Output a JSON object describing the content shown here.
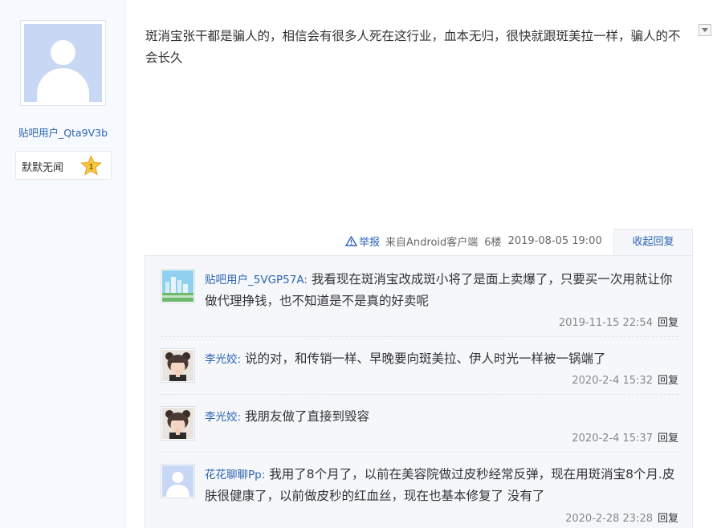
{
  "user": {
    "name": "贴吧用户_Qta9V3b",
    "level_title": "默默无闻",
    "level": "1"
  },
  "post": {
    "content": "斑消宝张干都是骗人的，相信会有很多人死在这行业，血本无归，很快就跟斑美拉一样，骗人的不会长久",
    "report_label": "举报",
    "source": "来自Android客户端",
    "floor": "6楼",
    "time": "2019-08-05 19:00",
    "collapse_label": "收起回复"
  },
  "replies": [
    {
      "user": "贴吧用户_5VGP57A:",
      "text": "我看现在斑消宝改成斑小将了是面上卖爆了，只要买一次用就让你做代理挣钱，也不知道是不是真的好卖呢",
      "time": "2019-11-15 22:54",
      "reply_label": "回复",
      "avatar": "landscape-avatar-icon"
    },
    {
      "user": "李光姣:",
      "text": "说的对，和传销一样、早晚要向斑美拉、伊人时光一样被一锅端了",
      "time": "2020-2-4 15:32",
      "reply_label": "回复",
      "avatar": "girl-photo-avatar"
    },
    {
      "user": "李光姣:",
      "text": "我朋友做了直接到毁容",
      "time": "2020-2-4 15:37",
      "reply_label": "回复",
      "avatar": "girl-photo-avatar"
    },
    {
      "user": "花花聊聊Pp:",
      "text": "我用了8个月了，以前在美容院做过皮秒经常反弹，现在用斑消宝8个月.皮肤很健康了，以前做皮秒的红血丝，现在也基本修复了 没有了",
      "time": "2020-2-28 23:28",
      "reply_label": "回复",
      "avatar": "default-user-avatar"
    }
  ],
  "colors": {
    "link_blue": "#2d64b3",
    "panel_bg": "#f6f9fe",
    "reply_bg": "#f5f7fa",
    "default_avatar_bg": "#c8d8f4",
    "star_gold": "#f7c942"
  }
}
